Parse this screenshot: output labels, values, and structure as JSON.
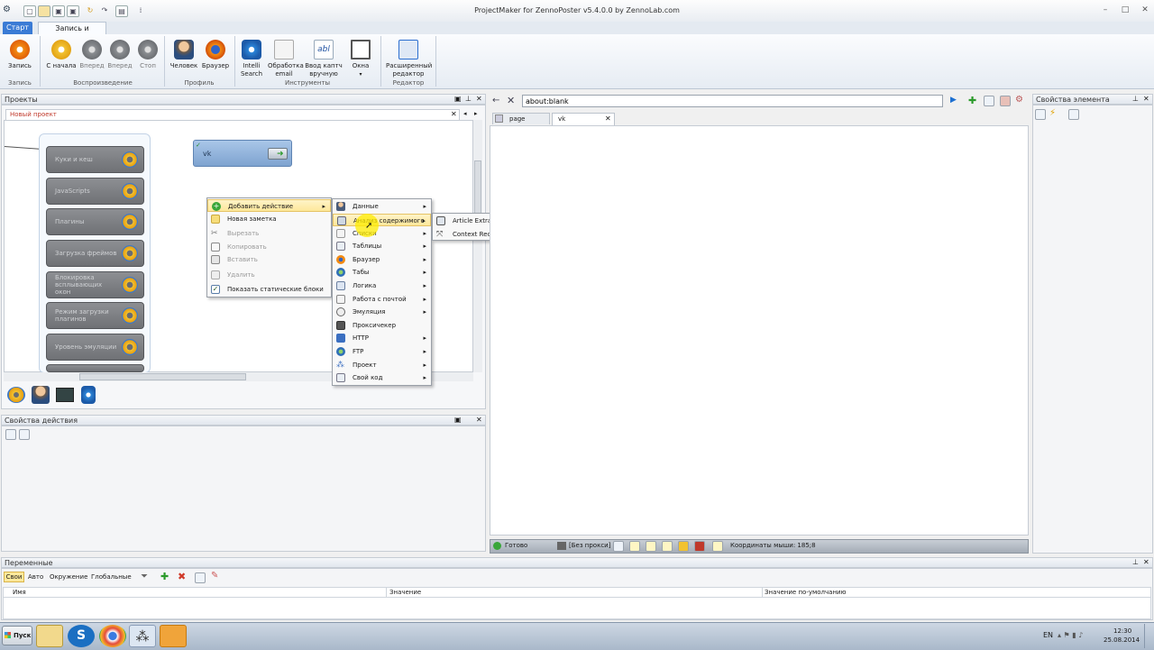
{
  "window": {
    "title": "ProjectMaker for ZennoPoster v5.4.0.0 by ZennoLab.com",
    "minimize": "–",
    "maximize": "□",
    "close": "✕"
  },
  "ribbon": {
    "tabs": [
      "Старт",
      "Запись и отладка"
    ],
    "groups": [
      {
        "label": "Запись",
        "buttons": [
          "Запись"
        ]
      },
      {
        "label": "Воспроизведение",
        "buttons": [
          "С начала",
          "Вперед",
          "Вперед",
          "Стоп"
        ]
      },
      {
        "label": "Профиль",
        "buttons": [
          "Человек",
          "Браузер"
        ]
      },
      {
        "label": "Инструменты",
        "buttons": [
          "Intelli Search",
          "Обработка email",
          "Ввод каптч вручную",
          "Окна"
        ]
      },
      {
        "label": "Редактор",
        "buttons": [
          "Расширенный редактор"
        ]
      }
    ]
  },
  "projects_panel": {
    "title": "Проекты",
    "tab": "Новый проект",
    "blocks": [
      "Куки и кеш",
      "JavaScripts",
      "Плагины",
      "Загрузка фреймов",
      "Блокировка всплывающих окон",
      "Режим загрузки плагинов",
      "Уровень эмуляции"
    ],
    "vk_node": "vk"
  },
  "context_menu": {
    "items": [
      {
        "label": "Добавить действие",
        "icon": "plus-icon",
        "submenu": true,
        "highlighted": true,
        "disabled": false
      },
      {
        "label": "Новая заметка",
        "icon": "note-icon",
        "submenu": false,
        "highlighted": false,
        "disabled": false
      },
      {
        "label": "Вырезать",
        "icon": "scissors-icon",
        "submenu": false,
        "highlighted": false,
        "disabled": true
      },
      {
        "label": "Копировать",
        "icon": "copy-icon",
        "submenu": false,
        "highlighted": false,
        "disabled": true
      },
      {
        "label": "Вставить",
        "icon": "paste-icon",
        "submenu": false,
        "highlighted": false,
        "disabled": true
      },
      {
        "label": "Удалить",
        "icon": "delete-icon",
        "submenu": false,
        "highlighted": false,
        "disabled": true
      },
      {
        "label": "Показать статические блоки",
        "icon": "checkbox-icon",
        "submenu": false,
        "highlighted": false,
        "disabled": false
      }
    ]
  },
  "submenu": {
    "items": [
      "Данные",
      "Анализ содержимого",
      "Списки",
      "Таблицы",
      "Браузер",
      "Табы",
      "Логика",
      "Работа с почтой",
      "Эмуляция",
      "Проксичекер",
      "HTTP",
      "FTP",
      "Проект",
      "Свой код"
    ],
    "highlighted_index": 1
  },
  "submenu2": {
    "items": [
      "Article Extraction",
      "Context Recognition"
    ]
  },
  "browser": {
    "url": "about:blank",
    "tabs": [
      "page",
      "vk"
    ],
    "active_tab": "vk",
    "status": "Готово",
    "proxy": "[Без прокси]",
    "coords": "Координаты мыши: 185;8"
  },
  "element_properties": {
    "title": "Свойства элемента"
  },
  "action_properties": {
    "title": "Свойства действия"
  },
  "variables": {
    "title": "Переменные",
    "tabs": [
      "Свои",
      "Авто",
      "Окружение",
      "Глобальные"
    ],
    "columns": [
      "Имя",
      "Значение",
      "Значение по-умолчанию"
    ]
  },
  "taskbar": {
    "start": "Пуск",
    "lang": "EN",
    "time": "12:30",
    "date": "25.08.2014"
  },
  "colors": {
    "accent": "#3a7bd5",
    "menu_highlight": "#fde89a",
    "block_gray": "#7a7c80"
  }
}
